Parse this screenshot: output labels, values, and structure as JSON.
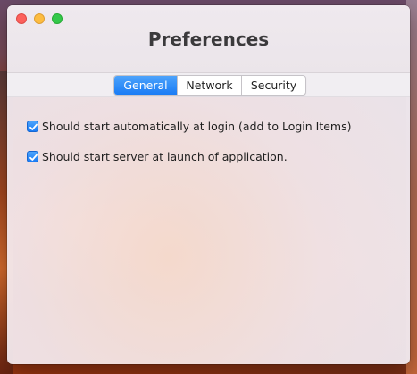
{
  "window": {
    "title": "Preferences"
  },
  "tabs": [
    {
      "label": "General",
      "selected": true
    },
    {
      "label": "Network",
      "selected": false
    },
    {
      "label": "Security",
      "selected": false
    }
  ],
  "options": [
    {
      "label": "Should start automatically at login (add to Login Items)",
      "checked": true
    },
    {
      "label": "Should start server at launch of application.",
      "checked": true
    }
  ],
  "colors": {
    "accent": "#1a7cf5",
    "close": "#fc605c",
    "minimize": "#fdbc40",
    "maximize": "#34c84a"
  }
}
